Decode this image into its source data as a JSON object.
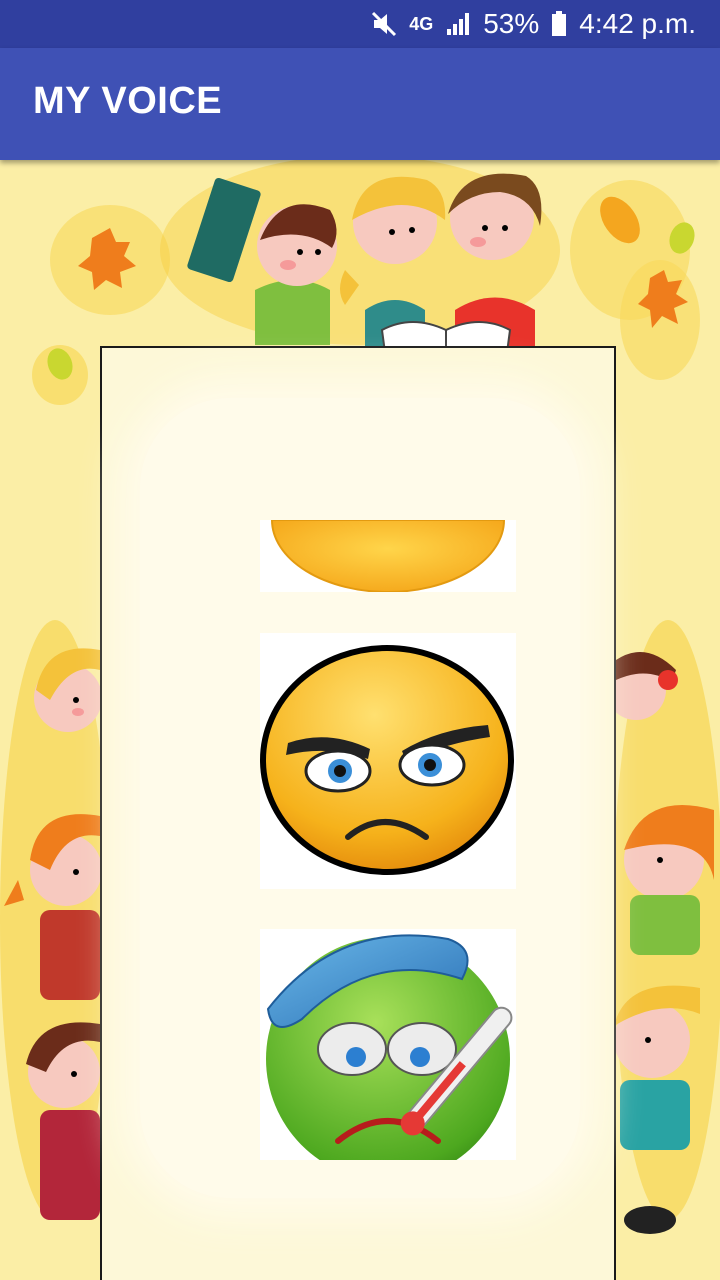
{
  "status_bar": {
    "network": "4G",
    "battery_percent": "53%",
    "time": "4:42 p.m.",
    "icons": [
      "mute-icon",
      "network-4g-icon",
      "signal-icon",
      "battery-icon"
    ]
  },
  "app_bar": {
    "title": "MY VOICE",
    "color": "#3f51b5",
    "status_color": "#303f9f"
  },
  "emotion_list": {
    "items": [
      {
        "name": "happy-emoji",
        "partially_visible": true
      },
      {
        "name": "angry-emoji"
      },
      {
        "name": "sick-emoji"
      }
    ]
  },
  "background": {
    "color": "#fbeea6",
    "theme": "cartoon-kids-frame"
  }
}
